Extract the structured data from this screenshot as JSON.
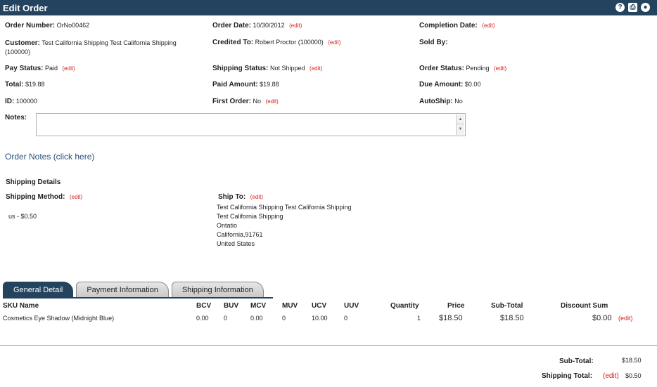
{
  "window": {
    "title": "Edit Order",
    "icons": [
      "help-icon",
      "print-icon",
      "close-icon"
    ]
  },
  "edit_label": "(edit)",
  "fields": {
    "order_number": {
      "label": "Order Number:",
      "value": "OrNo00462"
    },
    "order_date": {
      "label": "Order Date:",
      "value": "10/30/2012"
    },
    "completion_date": {
      "label": "Completion Date:",
      "value": ""
    },
    "customer": {
      "label": "Customer:",
      "value": "Test California Shipping Test California Shipping",
      "value2": "(100000)"
    },
    "credited_to": {
      "label": "Credited To:",
      "value": "Robert Proctor (100000)"
    },
    "sold_by": {
      "label": "Sold By:",
      "value": ""
    },
    "pay_status": {
      "label": "Pay Status:",
      "value": "Paid"
    },
    "shipping_status": {
      "label": "Shipping Status:",
      "value": "Not Shipped"
    },
    "order_status": {
      "label": "Order Status:",
      "value": "Pending"
    },
    "total": {
      "label": "Total:",
      "value": "$19.88"
    },
    "paid_amount": {
      "label": "Paid Amount:",
      "value": "$19.88"
    },
    "due_amount": {
      "label": "Due Amount:",
      "value": "$0.00"
    },
    "id": {
      "label": "ID:",
      "value": "100000"
    },
    "first_order": {
      "label": "First Order:",
      "value": "No"
    },
    "autoship": {
      "label": "AutoShip:",
      "value": "No"
    },
    "notes": {
      "label": "Notes:",
      "value": ""
    }
  },
  "order_notes_link": "Order Notes (click here)",
  "shipping": {
    "section_title": "Shipping Details",
    "method_label": "Shipping Method:",
    "method_value": "us - $0.50",
    "ship_to_label": "Ship To:",
    "address": [
      "Test California Shipping Test California Shipping",
      "Test California Shipping",
      "Ontatio",
      "California,91761",
      "United States"
    ]
  },
  "tabs": [
    "General Detail",
    "Payment Information",
    "Shipping Information"
  ],
  "table": {
    "headers": [
      "SKU Name",
      "BCV",
      "BUV",
      "MCV",
      "MUV",
      "UCV",
      "UUV",
      "Quantity",
      "Price",
      "Sub-Total",
      "Discount Sum"
    ],
    "row": [
      "Cosmetics Eye Shadow (Midnight Blue)",
      "0.00",
      "0",
      "0.00",
      "0",
      "10.00",
      "0",
      "1",
      "$18.50",
      "$18.50",
      "$0.00"
    ]
  },
  "totals": {
    "subtotal_label": "Sub-Total:",
    "subtotal_value": "$18.50",
    "shipping_total_label": "Shipping Total:",
    "shipping_total_value": "$0.50"
  }
}
